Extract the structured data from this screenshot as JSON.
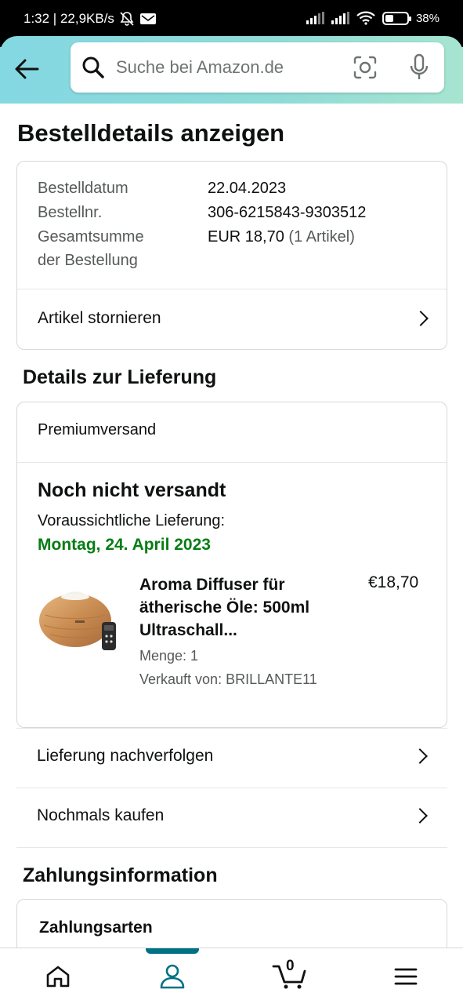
{
  "status_bar": {
    "time_speed": "1:32 | 22,9KB/s",
    "battery": "38",
    "battery_level": 0.38
  },
  "header": {
    "search_placeholder": "Suche bei Amazon.de",
    "icons": [
      "back-arrow-icon",
      "search-icon",
      "camera-icon",
      "microphone-icon"
    ]
  },
  "page_title": "Bestelldetails anzeigen",
  "order": {
    "date_label": "Bestelldatum",
    "date_value": "22.04.2023",
    "number_label": "Bestellnr.",
    "number_value": "306-6215843-9303512",
    "total_label_line1": "Gesamtsumme",
    "total_label_line2": "der Bestellung",
    "total_value": "EUR 18,70",
    "total_items": "(1 Artikel)",
    "cancel_label": "Artikel stornieren"
  },
  "delivery": {
    "section_title": "Details zur Lieferung",
    "shipping_type": "Premiumversand",
    "status": "Noch nicht versandt",
    "eta_label": "Voraussichtliche Lieferung:",
    "eta_date": "Montag, 24. April 2023",
    "eta_color": "#067d14",
    "product": {
      "title_line1": "Aroma Diffuser für",
      "title_line2": "ätherische Öle: 500ml",
      "title_line3": "Ultraschall...",
      "price": "€18,70",
      "quantity": "Menge: 1",
      "seller": "Verkauft von: BRILLANTE11"
    },
    "track_label": "Lieferung nachverfolgen",
    "buy_again_label": "Nochmals kaufen"
  },
  "payment": {
    "section_title": "Zahlungsinformation",
    "methods_title": "Zahlungsarten"
  },
  "bottom_nav": {
    "items": [
      "home-icon",
      "account-icon",
      "cart-icon",
      "menu-icon"
    ],
    "cart_count": "0",
    "active_color": "#007185"
  }
}
